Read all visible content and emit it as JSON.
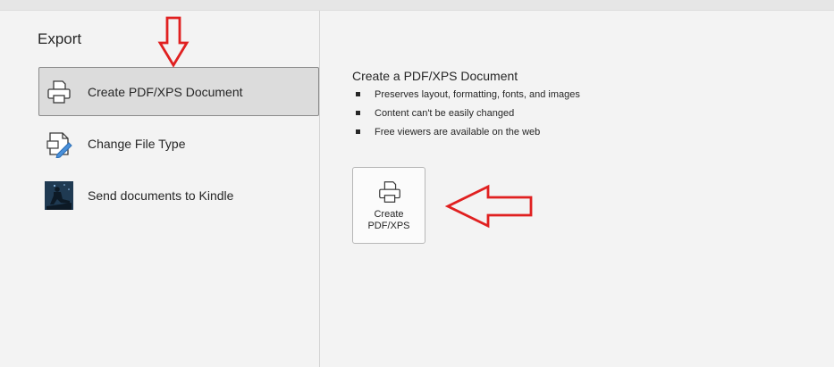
{
  "page_title": "Export",
  "export_options": [
    {
      "label": "Create PDF/XPS Document",
      "icon": "pdf-printer-icon",
      "selected": true
    },
    {
      "label": "Change File Type",
      "icon": "change-file-type-icon",
      "selected": false
    },
    {
      "label": "Send documents to Kindle",
      "icon": "kindle-icon",
      "selected": false
    }
  ],
  "detail": {
    "title": "Create a PDF/XPS Document",
    "bullets": [
      "Preserves layout, formatting, fonts, and images",
      "Content can't be easily changed",
      "Free viewers are available on the web"
    ],
    "button_label": "Create\nPDF/XPS",
    "button_icon": "pdf-printer-icon"
  },
  "annotations": {
    "color": "#e02020",
    "arrows": [
      "down-arrow-annotation",
      "left-arrow-annotation"
    ]
  }
}
